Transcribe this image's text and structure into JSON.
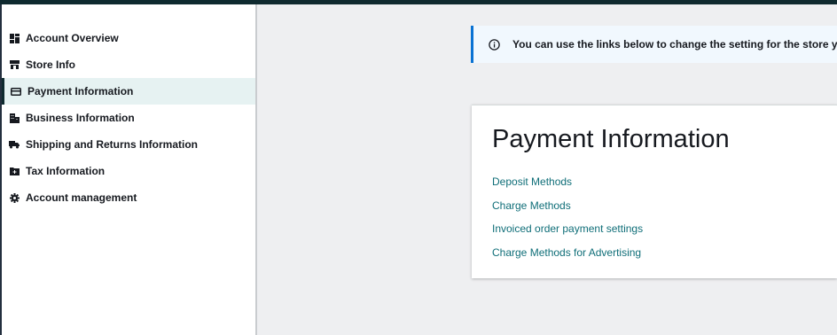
{
  "sidebar": {
    "items": [
      {
        "label": "Account Overview",
        "icon": "dashboard-icon"
      },
      {
        "label": "Store Info",
        "icon": "store-icon"
      },
      {
        "label": "Payment Information",
        "icon": "credit-card-icon"
      },
      {
        "label": "Business Information",
        "icon": "building-icon"
      },
      {
        "label": "Shipping and Returns Information",
        "icon": "truck-icon"
      },
      {
        "label": "Tax Information",
        "icon": "tax-folder-icon"
      },
      {
        "label": "Account management",
        "icon": "gear-icon"
      }
    ],
    "active_index": 2
  },
  "banner": {
    "text": "You can use the links below to change the setting for the store you",
    "icon": "info-icon"
  },
  "card": {
    "title": "Payment Information",
    "links": [
      {
        "label": "Deposit Methods"
      },
      {
        "label": "Charge Methods"
      },
      {
        "label": "Invoiced order payment settings"
      },
      {
        "label": "Charge Methods for Advertising"
      }
    ]
  },
  "colors": {
    "top_bar": "#0f2a2f",
    "page_bg": "#eeeff1",
    "active_nav_bg": "#e6f2f2",
    "link": "#0f6e78",
    "info_accent": "#0972d3"
  }
}
